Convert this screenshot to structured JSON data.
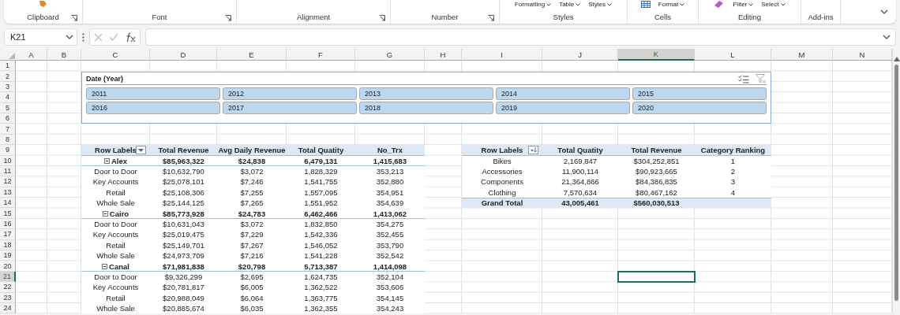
{
  "ribbon": {
    "groups": [
      {
        "label": "Clipboard",
        "launcher": true
      },
      {
        "label": "Font",
        "launcher": true
      },
      {
        "label": "Alignment",
        "launcher": true
      },
      {
        "label": "Number",
        "launcher": true
      },
      {
        "label": "Styles",
        "launcher": false,
        "buttons": [
          "Formatting",
          "Table",
          "Styles"
        ]
      },
      {
        "label": "Cells",
        "launcher": false,
        "buttons": [
          "Format"
        ]
      },
      {
        "label": "Editing",
        "launcher": false,
        "buttons": [
          "Filter",
          "Select"
        ]
      },
      {
        "label": "Add-ins",
        "launcher": false
      }
    ]
  },
  "formula_bar": {
    "name_box": "K21"
  },
  "columns": [
    {
      "label": "A",
      "selected": false
    },
    {
      "label": "B",
      "selected": false
    },
    {
      "label": "C",
      "selected": false
    },
    {
      "label": "D",
      "selected": false
    },
    {
      "label": "E",
      "selected": false
    },
    {
      "label": "F",
      "selected": false
    },
    {
      "label": "G",
      "selected": false
    },
    {
      "label": "H",
      "selected": false
    },
    {
      "label": "I",
      "selected": false
    },
    {
      "label": "J",
      "selected": false
    },
    {
      "label": "K",
      "selected": true
    },
    {
      "label": "L",
      "selected": false
    },
    {
      "label": "M",
      "selected": false
    },
    {
      "label": "N",
      "selected": false
    }
  ],
  "rows": [
    {
      "label": "1",
      "selected": false
    },
    {
      "label": "2",
      "selected": false
    },
    {
      "label": "3",
      "selected": false
    },
    {
      "label": "4",
      "selected": false
    },
    {
      "label": "5",
      "selected": false
    },
    {
      "label": "6",
      "selected": false
    },
    {
      "label": "7",
      "selected": false
    },
    {
      "label": "8",
      "selected": false
    },
    {
      "label": "9",
      "selected": false
    },
    {
      "label": "10",
      "selected": false
    },
    {
      "label": "11",
      "selected": false
    },
    {
      "label": "12",
      "selected": false
    },
    {
      "label": "13",
      "selected": false
    },
    {
      "label": "14",
      "selected": false
    },
    {
      "label": "15",
      "selected": false
    },
    {
      "label": "16",
      "selected": false
    },
    {
      "label": "17",
      "selected": false
    },
    {
      "label": "18",
      "selected": false
    },
    {
      "label": "19",
      "selected": false
    },
    {
      "label": "20",
      "selected": false
    },
    {
      "label": "21",
      "selected": true
    },
    {
      "label": "22",
      "selected": false
    },
    {
      "label": "23",
      "selected": false
    },
    {
      "label": "24",
      "selected": false
    }
  ],
  "slicer": {
    "title": "Date (Year)",
    "items": [
      {
        "label": "2011",
        "selected": true
      },
      {
        "label": "2012",
        "selected": true
      },
      {
        "label": "2013",
        "selected": true
      },
      {
        "label": "2014",
        "selected": true
      },
      {
        "label": "2015",
        "selected": true
      },
      {
        "label": "2016",
        "selected": true
      },
      {
        "label": "2017",
        "selected": true
      },
      {
        "label": "2018",
        "selected": true
      },
      {
        "label": "2019",
        "selected": true
      },
      {
        "label": "2020",
        "selected": true
      }
    ]
  },
  "pivot_1": {
    "columns": [
      "Row Labels",
      "Total Revenue",
      "Avg Daily Revenue",
      "Total Quatity",
      "No_Trx"
    ],
    "rows": [
      {
        "kind": "group",
        "label": "Alex",
        "values": [
          "$85,963,322",
          "$24,838",
          "6,479,131",
          "1,415,683"
        ]
      },
      {
        "kind": "item",
        "label": "Door to Door",
        "values": [
          "$10,632,790",
          "$3,072",
          "1,828,329",
          "353,213"
        ]
      },
      {
        "kind": "item",
        "label": "Key Accounts",
        "values": [
          "$25,078,101",
          "$7,246",
          "1,541,755",
          "352,880"
        ]
      },
      {
        "kind": "item",
        "label": "Retail",
        "values": [
          "$25,108,306",
          "$7,255",
          "1,557,095",
          "354,951"
        ]
      },
      {
        "kind": "item",
        "label": "Whole Sale",
        "values": [
          "$25,144,125",
          "$7,265",
          "1,551,952",
          "354,639"
        ]
      },
      {
        "kind": "group",
        "label": "Cairo",
        "values": [
          "$85,773,928",
          "$24,783",
          "6,462,466",
          "1,413,062"
        ]
      },
      {
        "kind": "item",
        "label": "Door to Door",
        "values": [
          "$10,631,043",
          "$3,072",
          "1,832,850",
          "354,275"
        ]
      },
      {
        "kind": "item",
        "label": "Key Accounts",
        "values": [
          "$25,019,475",
          "$7,229",
          "1,542,336",
          "352,455"
        ]
      },
      {
        "kind": "item",
        "label": "Retail",
        "values": [
          "$25,149,701",
          "$7,267",
          "1,546,052",
          "353,790"
        ]
      },
      {
        "kind": "item",
        "label": "Whole Sale",
        "values": [
          "$24,973,709",
          "$7,216",
          "1,541,228",
          "352,542"
        ]
      },
      {
        "kind": "group",
        "label": "Canal",
        "values": [
          "$71,981,838",
          "$20,798",
          "5,713,387",
          "1,414,098"
        ]
      },
      {
        "kind": "item",
        "label": "Door to Door",
        "values": [
          "$9,326,299",
          "$2,695",
          "1,624,735",
          "352,104"
        ]
      },
      {
        "kind": "item",
        "label": "Key Accounts",
        "values": [
          "$20,781,817",
          "$6,005",
          "1,362,522",
          "353,606"
        ]
      },
      {
        "kind": "item",
        "label": "Retail",
        "values": [
          "$20,988,049",
          "$6,064",
          "1,363,775",
          "354,145"
        ]
      },
      {
        "kind": "item",
        "label": "Whole Sale",
        "values": [
          "$20,885,674",
          "$6,035",
          "1,362,355",
          "354,243"
        ]
      }
    ]
  },
  "pivot_2": {
    "columns": [
      "Row Labels",
      "Total Quatity",
      "Total Revenue",
      "Category Ranking"
    ],
    "rows": [
      {
        "kind": "item",
        "label": "Bikes",
        "values": [
          "2,169,847",
          "$304,252,851",
          "1"
        ]
      },
      {
        "kind": "item",
        "label": "Accessories",
        "values": [
          "11,900,114",
          "$90,923,665",
          "2"
        ]
      },
      {
        "kind": "item",
        "label": "Components",
        "values": [
          "21,364,866",
          "$84,386,835",
          "3"
        ]
      },
      {
        "kind": "item",
        "label": "Clothing",
        "values": [
          "7,570,634",
          "$80,467,162",
          "4"
        ]
      },
      {
        "kind": "total",
        "label": "Grand Total",
        "values": [
          "43,005,461",
          "$560,030,513"
        ]
      }
    ]
  }
}
